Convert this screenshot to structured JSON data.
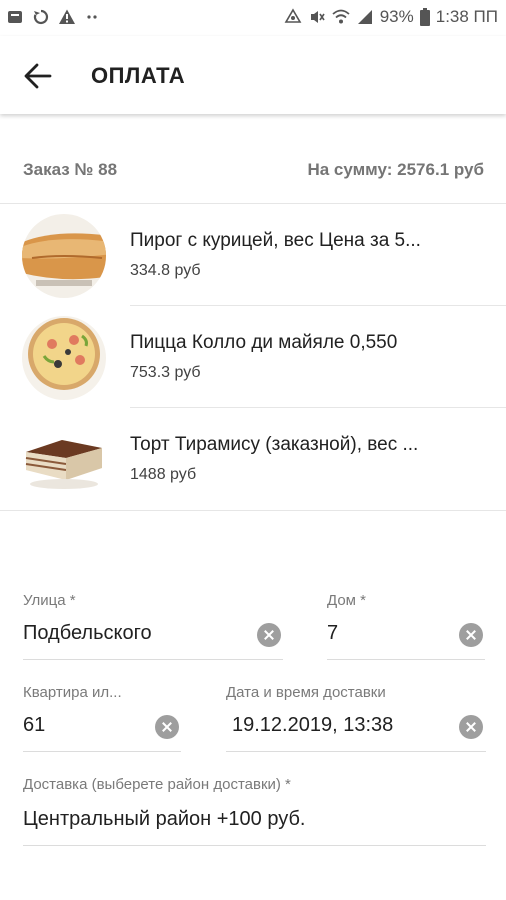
{
  "status_bar": {
    "battery": "93%",
    "time": "1:38 ПП",
    "left_icons": [
      "notification-icon",
      "sync-icon",
      "warning-icon",
      "more-dots-icon"
    ],
    "right_icons": [
      "nfc-icon",
      "mute-icon",
      "wifi-icon",
      "signal-icon",
      "battery-icon"
    ]
  },
  "app_bar": {
    "title": "ОПЛАТА",
    "back_icon": "arrow-left-icon"
  },
  "order": {
    "number_label": "Заказ № 88",
    "sum_label": "На сумму: 2576.1  руб"
  },
  "items": [
    {
      "name": "Пирог с курицей, вес Цена за 5...",
      "price": "334.8  руб",
      "image": "pie-image"
    },
    {
      "name": "Пицца Колло ди майяле 0,550",
      "price": "753.3  руб",
      "image": "pizza-image"
    },
    {
      "name": "Торт Тирамису (заказной), вес ...",
      "price": "1488  руб",
      "image": "tiramisu-image"
    }
  ],
  "form": {
    "street": {
      "label": "Улица *",
      "value": "Подбельского"
    },
    "house": {
      "label": "Дом *",
      "value": "7"
    },
    "apartment": {
      "label": "Квартира ил...",
      "value": "61"
    },
    "datetime": {
      "label": "Дата и время доставки",
      "value": "19.12.2019, 13:38"
    },
    "delivery": {
      "label": "Доставка (выберете район доставки) *",
      "value": "Центральный район +100 руб."
    }
  },
  "colors": {
    "text_primary": "#212121",
    "text_secondary": "#757575",
    "clear_button": "#9e9e9e",
    "divider": "#e6e6e6"
  }
}
